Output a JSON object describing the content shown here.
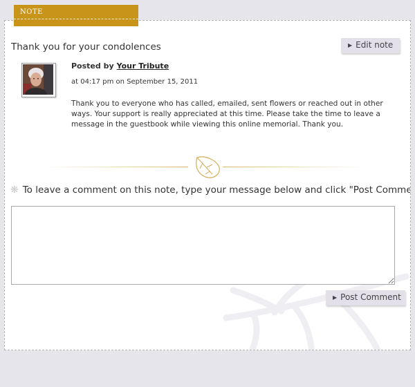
{
  "tab": {
    "label": "NOTE"
  },
  "note": {
    "title": "Thank you for your condolences",
    "edit_label": "Edit note",
    "posted_prefix": "Posted by",
    "author": "Your Tribute",
    "meta": "at 04:17 pm on September 15, 2011",
    "body": "Thank you to everyone who has called, emailed, sent flowers or reached out in other ways. Your support is really appreciated at this time. Please take the time to leave a message in the guestbook while viewing this online memorial. Thank you."
  },
  "comment": {
    "heading": "To leave a comment on this note, type your message below and click \"Post Comment\"",
    "value": "",
    "post_label": "Post Comment"
  },
  "icons": {
    "tab": "note-tab-icon",
    "edit_arrow": "play-arrow-icon",
    "avatar": "avatar-photo",
    "divider": "leaf-divider-icon",
    "heading": "snowflake-icon",
    "post_arrow": "play-arrow-icon",
    "background": "leaf-watermark"
  },
  "colors": {
    "page_bg": "#e7e5ec",
    "tab": "#c8941a",
    "button_bg": "#e4e0ea",
    "divider_gold": "#d9b76a"
  }
}
